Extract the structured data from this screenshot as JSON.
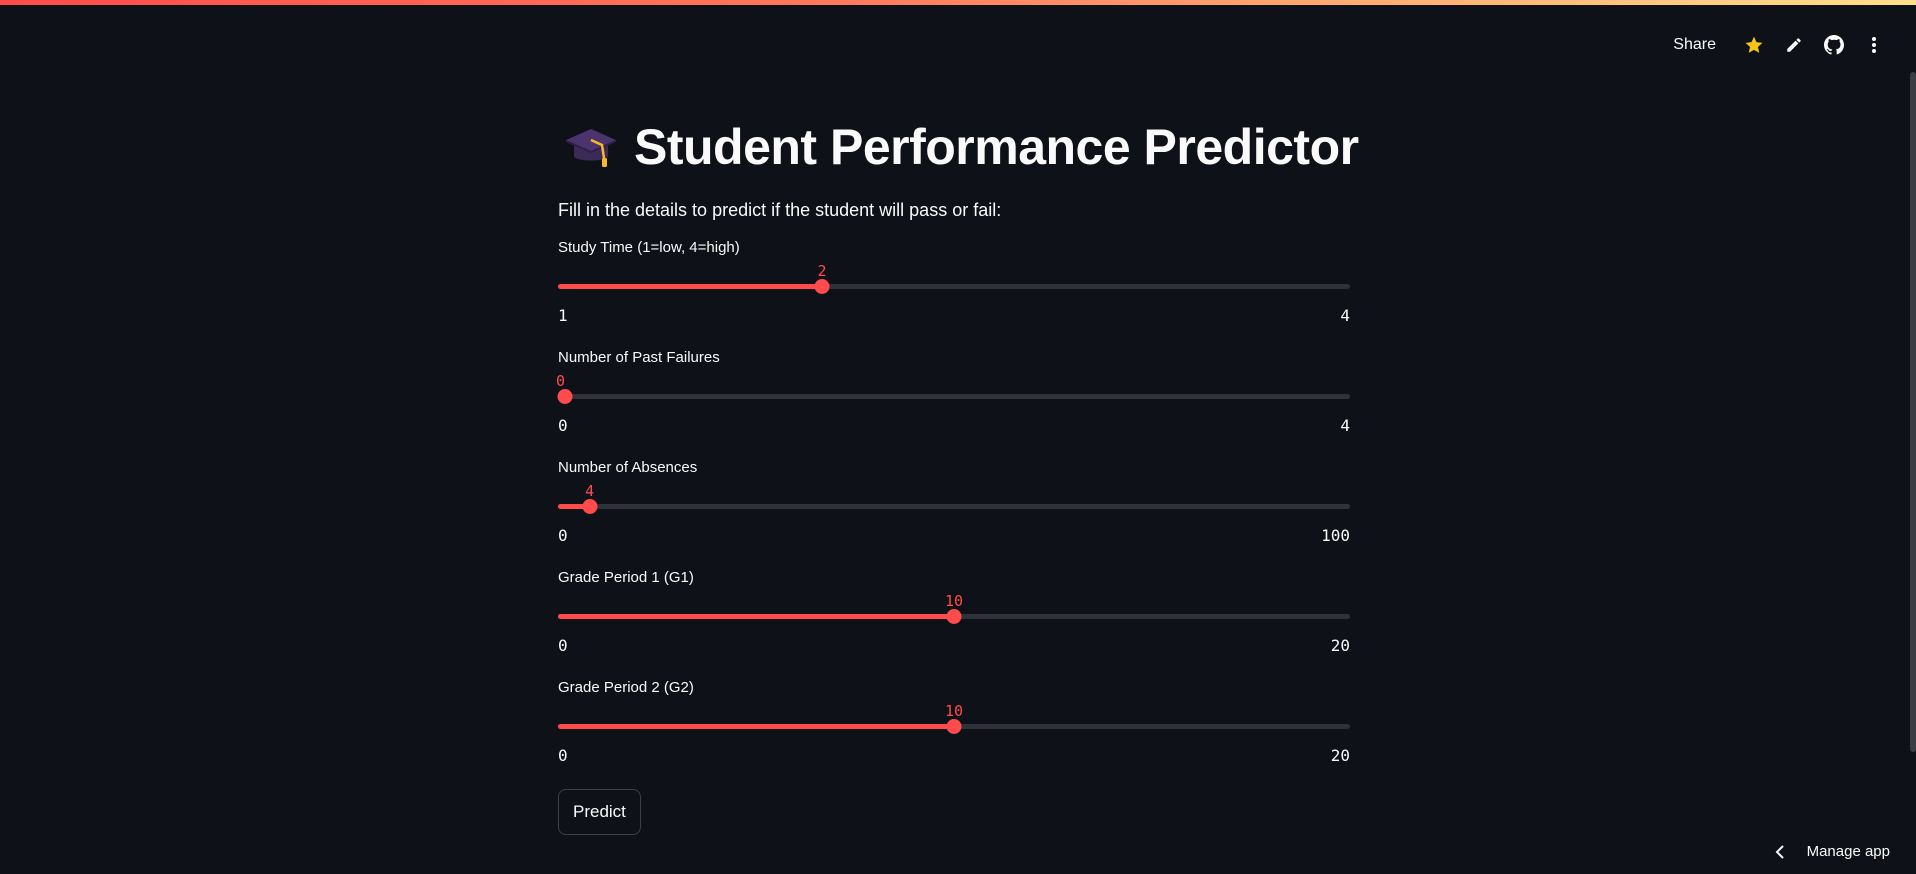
{
  "toolbar": {
    "share_label": "Share",
    "icons": [
      "star-icon",
      "pencil-icon",
      "github-icon",
      "kebab-menu-icon"
    ]
  },
  "header": {
    "emoji": "graduation-cap-icon",
    "title": "Student Performance Predictor"
  },
  "main": {
    "subtitle": "Fill in the details to predict if the student will pass or fail:",
    "sliders": [
      {
        "label": "Study Time (1=low, 4=high)",
        "value": 2,
        "min": 1,
        "max": 4
      },
      {
        "label": "Number of Past Failures",
        "value": 0,
        "min": 0,
        "max": 4
      },
      {
        "label": "Number of Absences",
        "value": 4,
        "min": 0,
        "max": 100
      },
      {
        "label": "Grade Period 1 (G1)",
        "value": 10,
        "min": 0,
        "max": 20
      },
      {
        "label": "Grade Period 2 (G2)",
        "value": 10,
        "min": 0,
        "max": 20
      }
    ],
    "predict_label": "Predict"
  },
  "footer": {
    "manage_label": "Manage app"
  },
  "colors": {
    "accent": "#ff4b4b",
    "background": "#0e1117",
    "track": "#2f323b",
    "text": "#fafafa"
  }
}
